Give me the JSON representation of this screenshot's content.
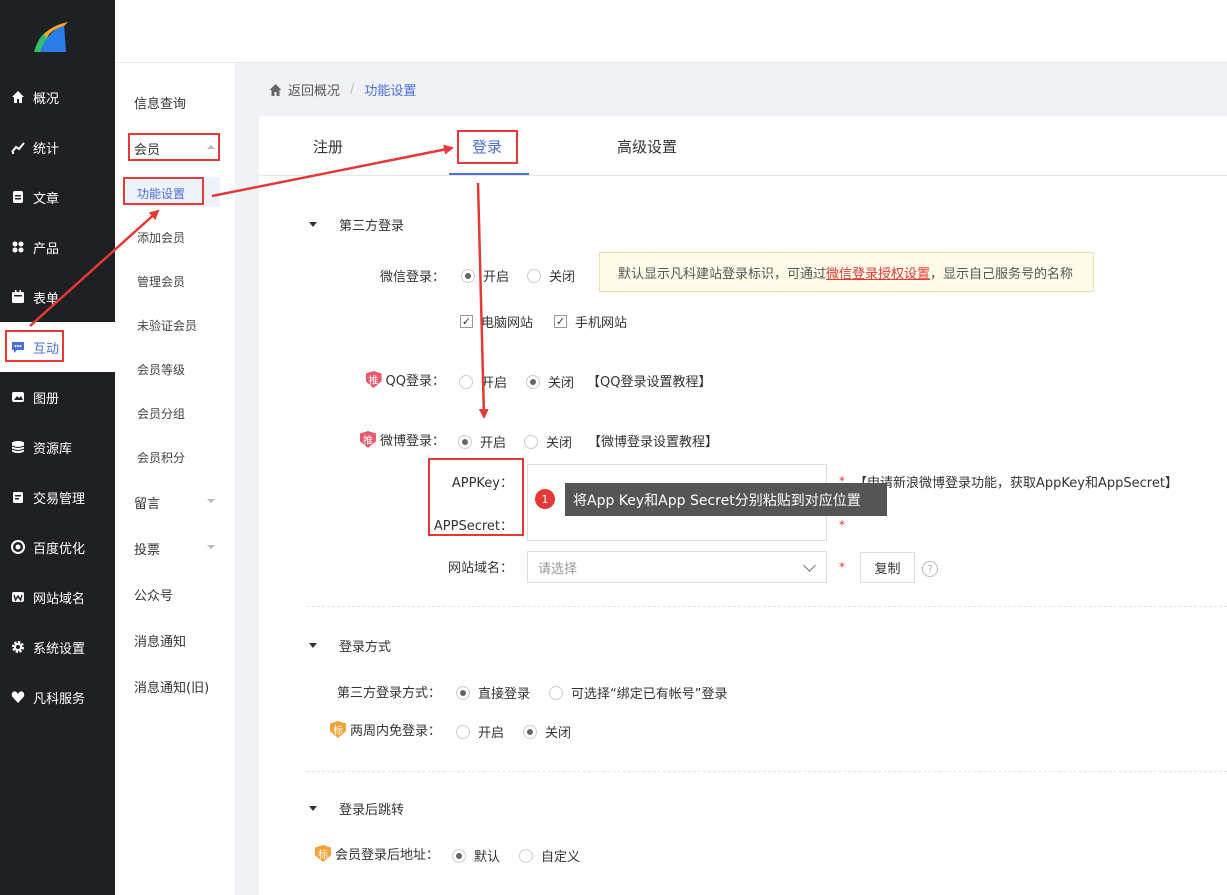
{
  "sidebar": {
    "items": [
      {
        "label": "概况",
        "icon": "home-icon"
      },
      {
        "label": "统计",
        "icon": "chart-icon"
      },
      {
        "label": "文章",
        "icon": "article-icon"
      },
      {
        "label": "产品",
        "icon": "grid-icon"
      },
      {
        "label": "表单",
        "icon": "calendar-icon"
      },
      {
        "label": "互动",
        "icon": "chat-icon"
      },
      {
        "label": "图册",
        "icon": "album-icon"
      },
      {
        "label": "资源库",
        "icon": "database-icon"
      },
      {
        "label": "交易管理",
        "icon": "trade-icon"
      },
      {
        "label": "百度优化",
        "icon": "target-icon"
      },
      {
        "label": "网站域名",
        "icon": "web-icon"
      },
      {
        "label": "系统设置",
        "icon": "gear-icon"
      },
      {
        "label": "凡科服务",
        "icon": "heart-icon"
      }
    ]
  },
  "submenu": {
    "info": "信息查询",
    "member": "会员",
    "feature": "功能设置",
    "add_member": "添加会员",
    "manage_member": "管理会员",
    "unverified": "未验证会员",
    "level": "会员等级",
    "group": "会员分组",
    "points": "会员积分",
    "message": "留言",
    "vote": "投票",
    "official": "公众号",
    "notify": "消息通知",
    "notify_old": "消息通知(旧)"
  },
  "breadcrumb": {
    "back": "返回概况",
    "sep": "/",
    "current": "功能设置"
  },
  "tabs": {
    "register": "注册",
    "login": "登录",
    "advanced": "高级设置"
  },
  "third_party": {
    "title": "第三方登录",
    "wechat_label": "微信登录：",
    "open": "开启",
    "close": "关闭",
    "notice_pre": "默认显示凡科建站登录标识，可通过",
    "notice_link": "微信登录授权设置",
    "notice_post": "，显示自己服务号的名称",
    "pc_site": "电脑网站",
    "mobile_site": "手机网站",
    "qq_label": "QQ登录：",
    "qq_tutorial": "【QQ登录设置教程】",
    "weibo_label": "微博登录：",
    "weibo_tutorial": "【微博登录设置教程】",
    "badge_push": "推",
    "appkey_label": "APPKey：",
    "appsecret_label": "APPSecret：",
    "apply_note": "【申请新浪微博登录功能，获取AppKey和AppSecret】",
    "domain_label": "网站域名：",
    "domain_placeholder": "请选择",
    "copy_btn": "复制",
    "help": "?",
    "required": "*"
  },
  "tooltip": {
    "num": "1",
    "text": "将App Key和App Secret分别粘贴到对应位置"
  },
  "login_method": {
    "title": "登录方式",
    "third_label": "第三方登录方式：",
    "direct": "直接登录",
    "bind": "可选择“绑定已有帐号”登录",
    "badge_std": "标",
    "twoweek_label": "两周内免登录：",
    "open": "开启",
    "close": "关闭"
  },
  "redirect": {
    "title": "登录后跳转",
    "addr_label": "会员登录后地址：",
    "default": "默认",
    "custom": "自定义"
  },
  "colors": {
    "accent": "#4a6fd8",
    "annotation": "#e53935",
    "sidebar": "#1f2024"
  }
}
